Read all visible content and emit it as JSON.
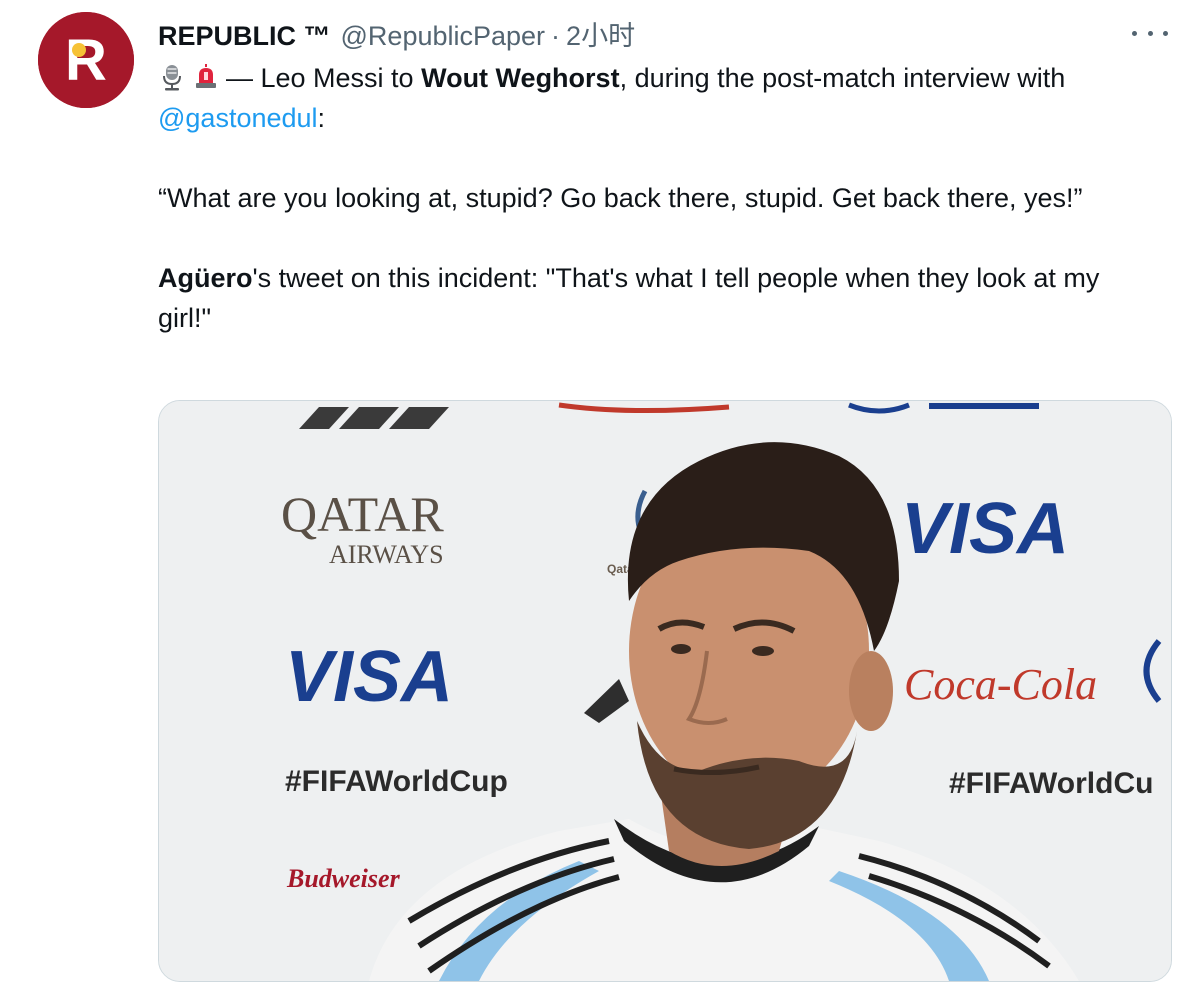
{
  "tweet": {
    "avatar_letter": "R",
    "display_name": "REPUBLIC ™",
    "handle": "@RepublicPaper",
    "separator": "·",
    "time": "2小时",
    "more_icon": "more-horizontal-icon",
    "emojis": [
      "studio-microphone-icon",
      "rotating-light-icon"
    ],
    "line1_prefix": "— Leo Messi to ",
    "line1_bold": "Wout Weghorst",
    "line1_suffix": ", during the post-match interview with ",
    "mention": "@gastonedul",
    "line1_end": ":",
    "quote": "“What are you looking at, stupid? Go back there, stupid. Get back there, yes!”",
    "para3_bold": "Agüero",
    "para3_text": "'s tweet on this incident: \"That's what I tell people when they look at my girl!\""
  },
  "media": {
    "board_texts": {
      "qatar": "QATAR",
      "airways": "AIRWAYS",
      "visa_left": "VISA",
      "visa_right": "VISA",
      "hashtag_left": "#FIFAWorldCup",
      "hashtag_right": "#FIFAWorldCu",
      "cocacola": "Coca-Cola",
      "budweiser": "Budweiser",
      "qatar_small": "Qatar"
    },
    "colors": {
      "brand_red": "#a5182a",
      "visa_blue": "#1a3f8f",
      "board_bg": "#eef0f1",
      "hair": "#2a1e18",
      "skin": "#c9906f",
      "shirt_stripe": "#8fc3e8"
    }
  }
}
